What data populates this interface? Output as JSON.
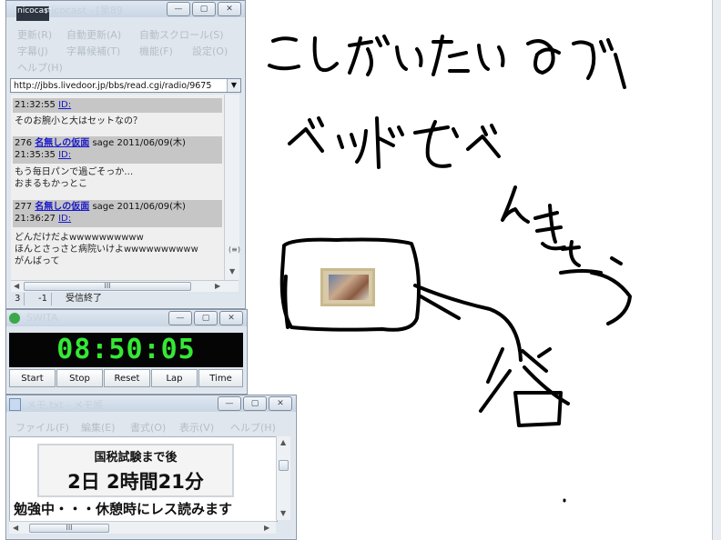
{
  "bbs_window": {
    "logo": "nicocast",
    "title": "nicocast - [第89",
    "menu": [
      "更新(R)",
      "自動更新(A)",
      "自動スクロール(S)",
      "字幕(J)",
      "字幕候補(T)",
      "機能(F)",
      "設定(O)",
      "ヘルプ(H)"
    ],
    "url": "http://jbbs.livedoor.jp/bbs/read.cgi/radio/9675",
    "posts": [
      {
        "header": "",
        "time": "21:32:55",
        "id": "ID:",
        "body": [
          "そのお腕小と大はセットなの？"
        ]
      },
      {
        "num": "276",
        "name": "名無しの仮面",
        "meta": "sage 2011/06/09(木)",
        "time": "21:35:35",
        "id": "ID:",
        "body": [
          "もう毎日パンで過ごそっか…",
          "おまるもかっとこ"
        ]
      },
      {
        "num": "277",
        "name": "名無しの仮面",
        "meta": "sage 2011/06/09(木)",
        "time": "21:36:27",
        "id": "ID:",
        "body": [
          "どんだけだよwwwwwwwwww",
          "ほんとさっさと病院いけよwwwwwwwwww",
          "がんばって"
        ]
      }
    ],
    "status": [
      "3",
      "-1",
      "受信終了"
    ]
  },
  "timer_window": {
    "title": "SWITA",
    "time": "08:50:05",
    "buttons": [
      "Start",
      "Stop",
      "Reset",
      "Lap",
      "Time"
    ]
  },
  "notepad_window": {
    "title": "メモ.txt - メモ帳",
    "menu": [
      "ファイル(F)",
      "編集(E)",
      "書式(O)",
      "表示(V)",
      "ヘルプ(H)"
    ],
    "box_line1": "国税試験まで後",
    "box_line2": "2日  2時間21分",
    "line": "勉強中・・・休憩時にレス読みます"
  },
  "drawing": {
    "handwriting_lines": [
      "こしがいたいので",
      "ベッドでべんきょう",
      "谷"
    ]
  },
  "colors": {
    "lcd_digits": "#35e835",
    "link": "#1818c8",
    "stroke": "#000000"
  }
}
